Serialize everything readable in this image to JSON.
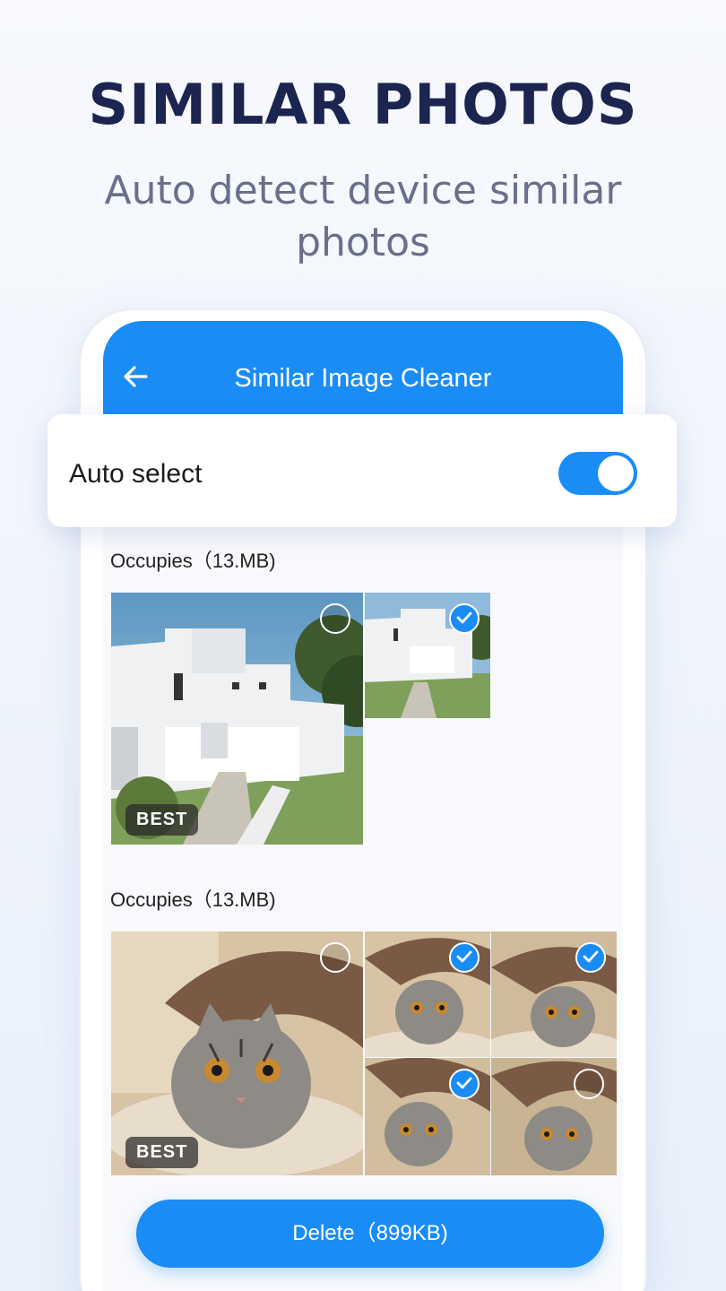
{
  "headline": "SIMILAR PHOTOS",
  "subheadline": "Auto detect device similar photos",
  "app_bar": {
    "title": "Similar Image Cleaner",
    "back_icon": "arrow-left-icon"
  },
  "auto_select": {
    "label": "Auto select",
    "enabled": true
  },
  "groups": [
    {
      "label": "Occupies（13.MB)",
      "photos": [
        {
          "subject": "house",
          "best": true,
          "selected": false
        },
        {
          "subject": "house",
          "best": false,
          "selected": true
        }
      ]
    },
    {
      "label": "Occupies（13.MB)",
      "photos": [
        {
          "subject": "cat",
          "best": true,
          "selected": false
        },
        {
          "subject": "cat",
          "best": false,
          "selected": true
        },
        {
          "subject": "cat",
          "best": false,
          "selected": true
        },
        {
          "subject": "cat",
          "best": false,
          "selected": true
        },
        {
          "subject": "cat",
          "best": false,
          "selected": false
        }
      ]
    }
  ],
  "best_label": "BEST",
  "delete_button": {
    "label": "Delete（899KB)"
  },
  "colors": {
    "accent": "#1a8cf5",
    "headline": "#1c2450",
    "subheadline": "#6a6f8a"
  }
}
